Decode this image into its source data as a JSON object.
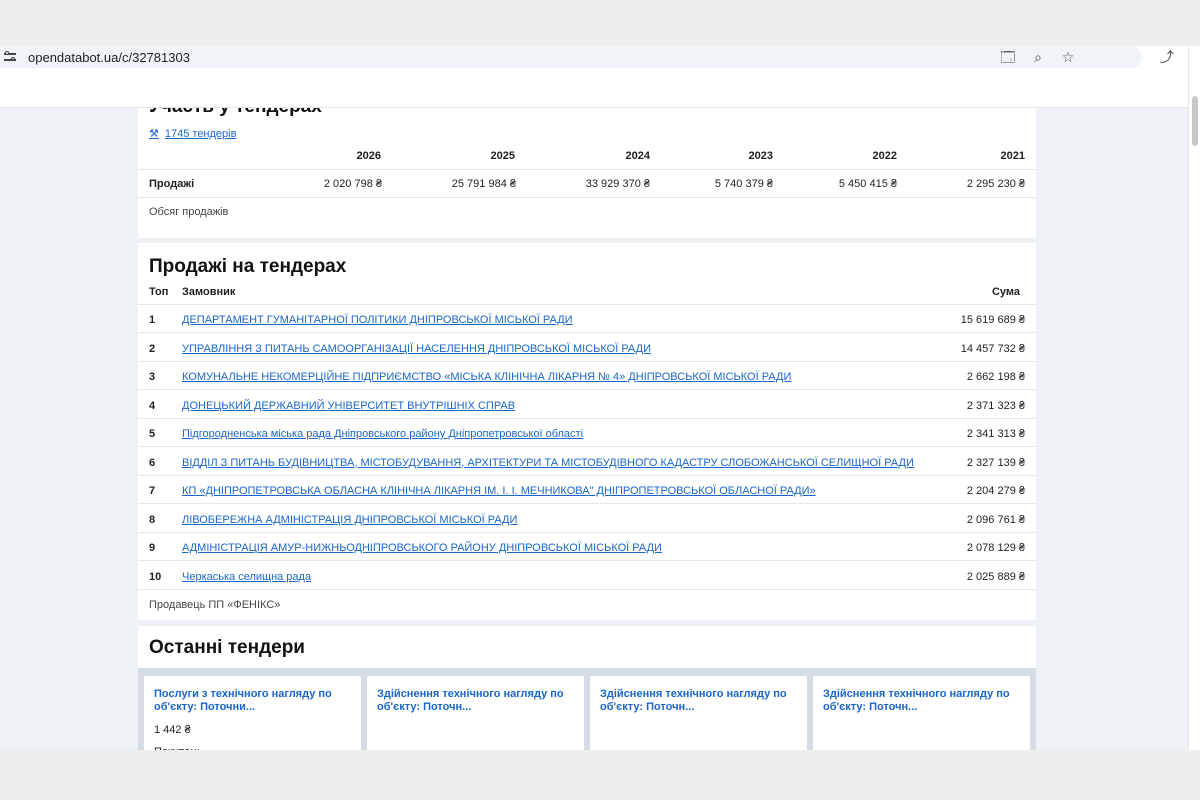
{
  "browser": {
    "url": "opendatabot.ua/c/32781303",
    "icons": [
      "translate-icon",
      "zoom-icon",
      "bookmark-star-icon",
      "extensions-icon"
    ]
  },
  "participation": {
    "title": "Участь у тендерах",
    "tender_link": "1745 тендерів",
    "years": [
      "2026",
      "2025",
      "2024",
      "2023",
      "2022",
      "2021"
    ],
    "sales_label": "Продажі",
    "sales": [
      "2 020 798 ₴",
      "25 791 984 ₴",
      "33 929 370 ₴",
      "5 740 379 ₴",
      "5 450 415 ₴",
      "2 295 230 ₴"
    ],
    "footer": "Обсяг продажів"
  },
  "tender_sales": {
    "title": "Продажі на тендерах",
    "headers": {
      "top": "Топ",
      "customer": "Замовник",
      "sum": "Сума"
    },
    "rows": [
      {
        "n": "1",
        "name": "ДЕПАРТАМЕНТ ГУМАНІТАРНОЇ ПОЛІТИКИ ДНІПРОВСЬКОЇ МІСЬКОЇ РАДИ",
        "sum": "15 619 689 ₴"
      },
      {
        "n": "2",
        "name": "УПРАВЛІННЯ З ПИТАНЬ САМООРГАНІЗАЦІЇ НАСЕЛЕННЯ ДНІПРОВСЬКОЇ МІСЬКОЇ РАДИ",
        "sum": "14 457 732 ₴"
      },
      {
        "n": "3",
        "name": "КОМУНАЛЬНЕ НЕКОМЕРЦІЙНЕ ПІДПРИЄМСТВО «МІСЬКА КЛІНІЧНА ЛІКАРНЯ № 4» ДНІПРОВСЬКОЇ МІСЬКОЇ РАДИ",
        "sum": "2 662 198 ₴"
      },
      {
        "n": "4",
        "name": "ДОНЕЦЬКИЙ ДЕРЖАВНИЙ УНІВЕРСИТЕТ ВНУТРІШНІХ СПРАВ",
        "sum": "2 371 323 ₴"
      },
      {
        "n": "5",
        "name": "Підгородненська міська рада Дніпровського району Дніпропетровської області",
        "sum": "2 341 313 ₴"
      },
      {
        "n": "6",
        "name": "ВІДДІЛ З ПИТАНЬ БУДІВНИЦТВА, МІСТОБУДУВАННЯ, АРХІТЕКТУРИ ТА МІСТОБУДІВНОГО КАДАСТРУ СЛОБОЖАНСЬКОЇ СЕЛИЩНОЇ РАДИ",
        "sum": "2 327 139 ₴"
      },
      {
        "n": "7",
        "name": "КП «ДНІПРОПЕТРОВСЬКА ОБЛАСНА КЛІНІЧНА ЛІКАРНЯ ІМ. І. І. МЕЧНИКОВА\" ДНІПРОПЕТРОВСЬКОЇ ОБЛАСНОЇ РАДИ»",
        "sum": "2 204 279 ₴"
      },
      {
        "n": "8",
        "name": "ЛІВОБЕРЕЖНА АДМІНІСТРАЦІЯ ДНІПРОВСЬКОЇ МІСЬКОЇ РАДИ",
        "sum": "2 096 761 ₴"
      },
      {
        "n": "9",
        "name": "АДМІНІСТРАЦІЯ АМУР-НИЖНЬОДНІПРОВСЬКОГО РАЙОНУ ДНІПРОВСЬКОЇ МІСЬКОЇ РАДИ",
        "sum": "2 078 129 ₴"
      },
      {
        "n": "10",
        "name": "Черкаська селищна рада",
        "sum": "2 025 889 ₴"
      }
    ],
    "footer": "Продавець ПП «ФЕНІКС»"
  },
  "recent_tenders": {
    "title": "Останні тендери",
    "cards": [
      {
        "title": "Послуги з технічного нагляду по об'єкту: Поточни...",
        "price": "1 442 ₴",
        "role": "Покупець"
      },
      {
        "title": "Здійснення технічного нагляду по об'єкту: Поточн...",
        "price": "",
        "role": ""
      },
      {
        "title": "Здійснення технічного нагляду по об'єкту: Поточн...",
        "price": "",
        "role": ""
      },
      {
        "title": "Здійснення технічного нагляду по об'єкту: Поточн...",
        "price": "",
        "role": ""
      }
    ]
  }
}
